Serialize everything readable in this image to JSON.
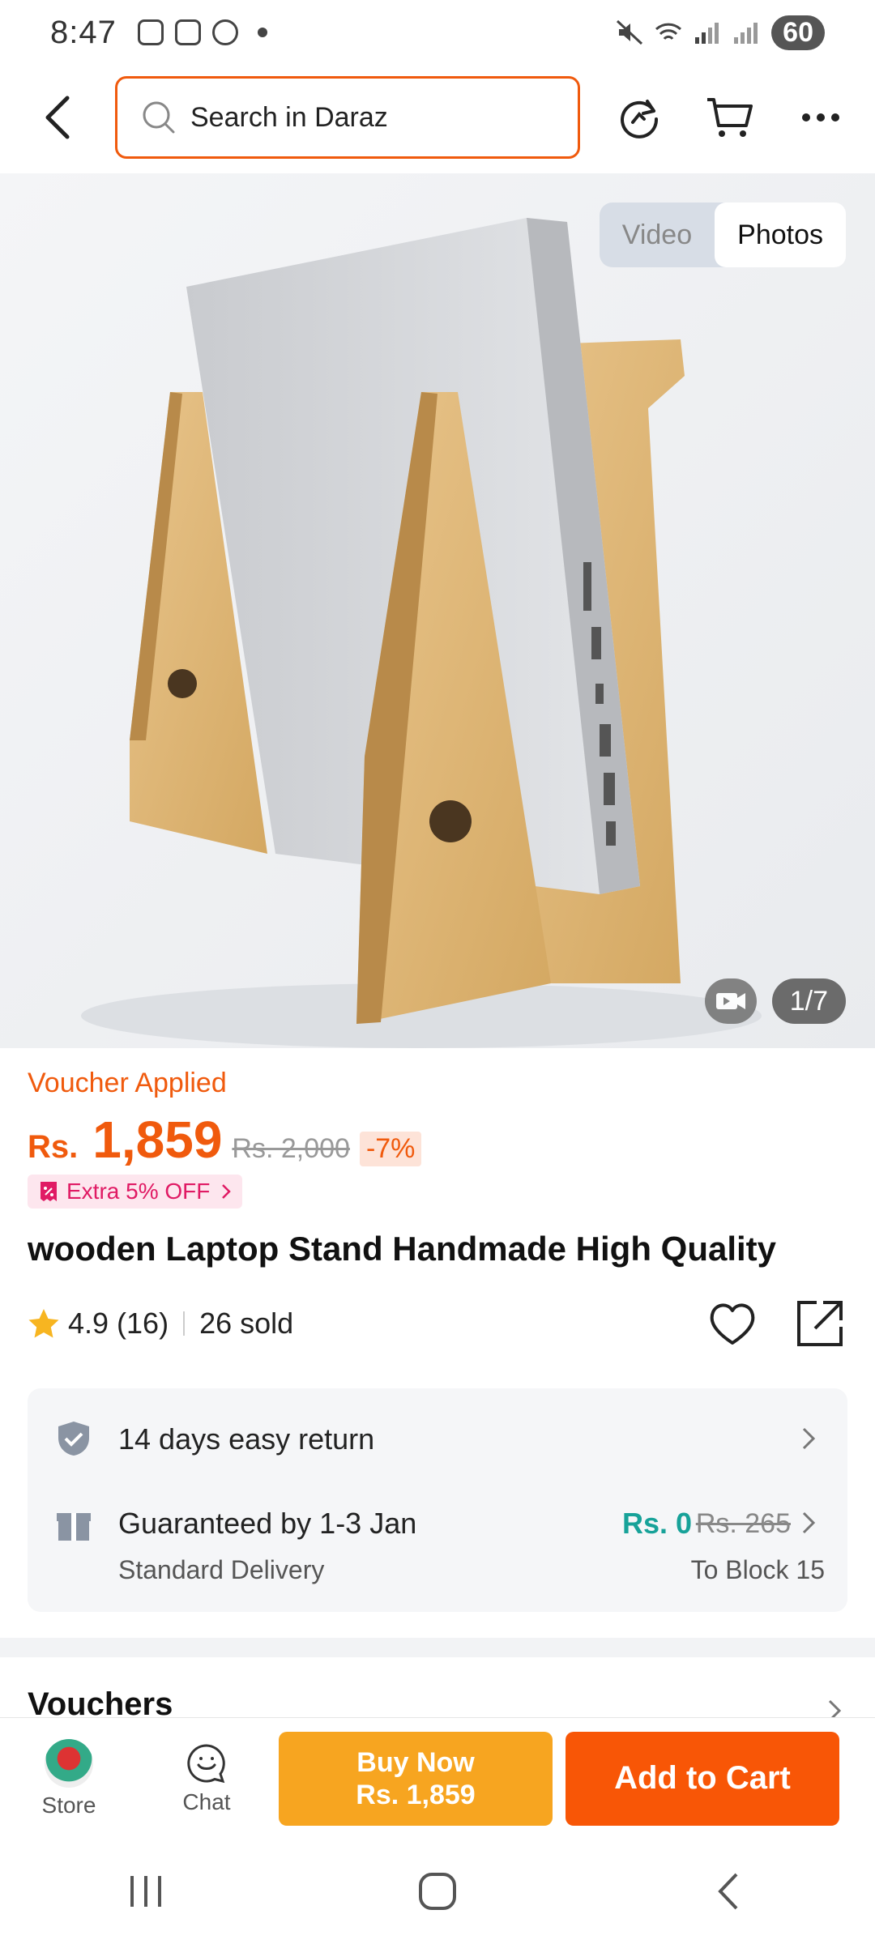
{
  "status_bar": {
    "time": "8:47",
    "battery": "60",
    "icons": [
      "gallery-icon",
      "instagram-icon",
      "whatsapp-icon",
      "mute-icon",
      "wifi-icon",
      "signal-icon"
    ]
  },
  "top_nav": {
    "search_placeholder": "Search in Daraz",
    "icons": [
      "back-arrow-icon",
      "search-icon",
      "refresh-icon",
      "cart-icon",
      "more-icon"
    ]
  },
  "gallery": {
    "media_tabs": [
      "Video",
      "Photos"
    ],
    "active_tab": "Photos",
    "counter": "1/7"
  },
  "price": {
    "voucher_label": "Voucher Applied",
    "currency": "Rs.",
    "current": "1,859",
    "original": "Rs. 2,000",
    "discount": "-7%",
    "extra_offer": "Extra 5% OFF"
  },
  "product": {
    "title": "wooden Laptop Stand Handmade High Quality",
    "rating": "4.9",
    "reviews": "(16)",
    "sold": "26 sold"
  },
  "services": {
    "return_label": "14 days easy return",
    "delivery_label": "Guaranteed by 1-3 Jan",
    "delivery_type": "Standard Delivery",
    "delivery_fee": "Rs. 0",
    "delivery_fee_original": "Rs. 265",
    "destination": "To Block 15"
  },
  "vouchers": {
    "title": "Vouchers"
  },
  "action_bar": {
    "store_label": "Store",
    "chat_label": "Chat",
    "buy_now_label": "Buy Now",
    "buy_now_price": "Rs. 1,859",
    "add_to_cart_label": "Add to Cart"
  },
  "colors": {
    "accent": "#f05a0d",
    "buy_now": "#f7a520",
    "add_to_cart": "#f85606",
    "free_delivery": "#17a299",
    "promo_pink": "#e01a64"
  }
}
